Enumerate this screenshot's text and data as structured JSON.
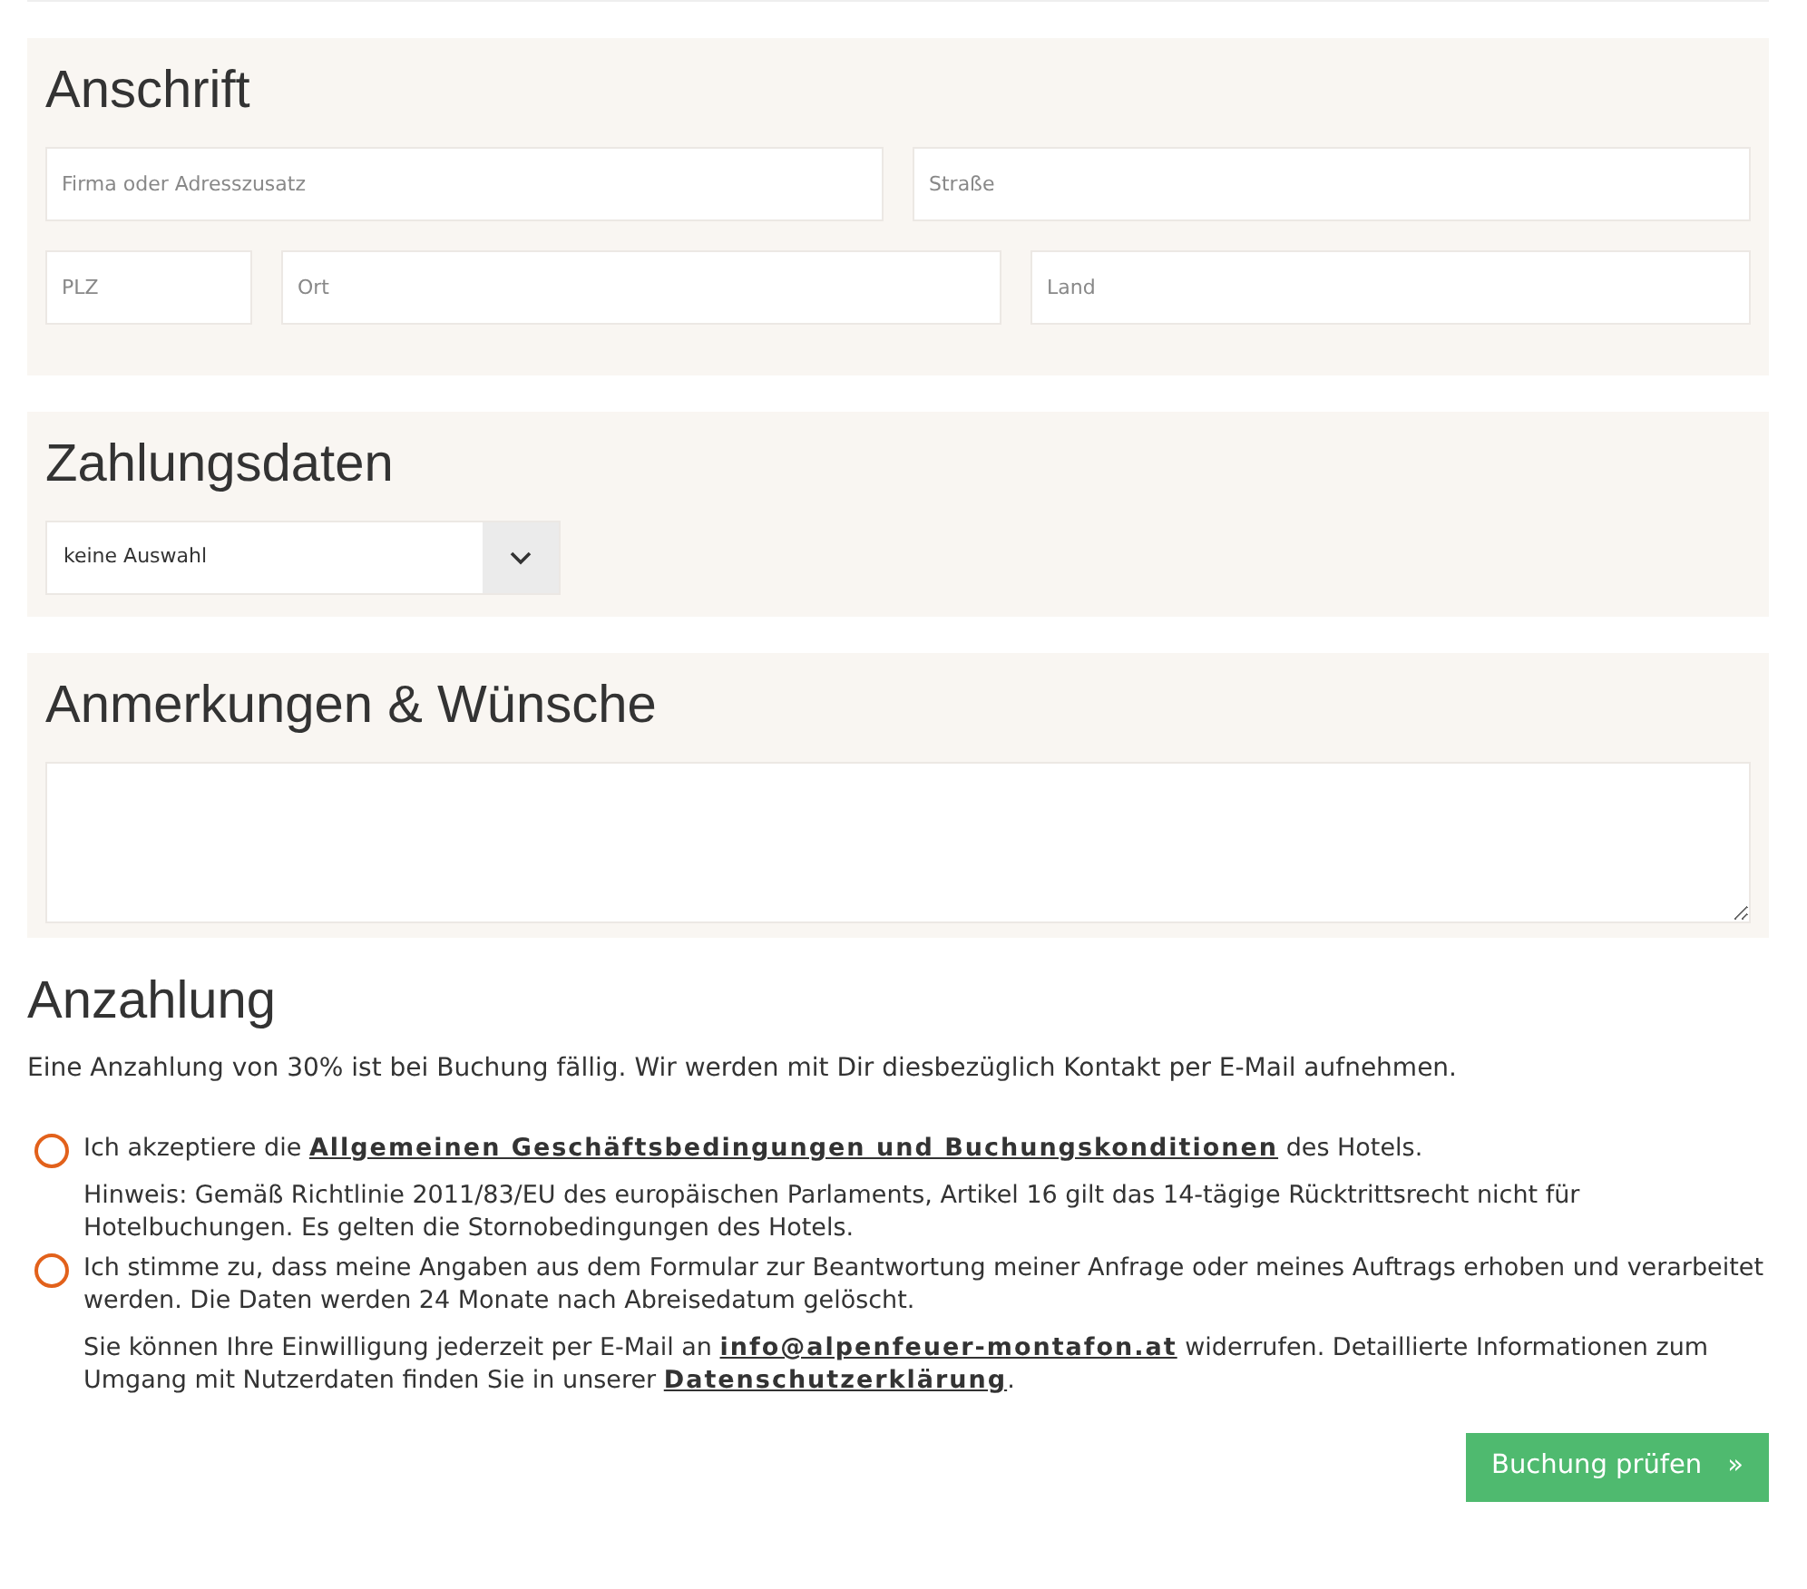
{
  "address": {
    "title": "Anschrift",
    "fields": [
      {
        "placeholder": "Firma oder Adresszusatz"
      },
      {
        "placeholder": "Straße"
      },
      {
        "placeholder": "PLZ"
      },
      {
        "placeholder": "Ort"
      },
      {
        "placeholder": "Land"
      }
    ]
  },
  "payment": {
    "title": "Zahlungsdaten",
    "select_value": "keine Auswahl"
  },
  "notes": {
    "title": "Anmerkungen & Wünsche"
  },
  "deposit": {
    "title": "Anzahlung",
    "text": "Eine Anzahlung von 30% ist bei Buchung fällig. Wir werden mit Dir diesbezüglich Kontakt per E-Mail aufnehmen.",
    "consents": [
      {
        "checked": false,
        "before": "Ich akzeptiere die",
        "link": "Allgemeinen Geschäftsbedingungen und Buchungskonditionen",
        "after": "des Hotels.",
        "note": [
          {
            "text": "Hinweis: Gemäß Richtlinie 2011/83/EU des europäischen Parlaments, Artikel 16 gilt das 14-tägige Rücktrittsrecht nicht für Hotelbuchungen. Es gelten die Stornobedingungen des Hotels."
          }
        ]
      },
      {
        "checked": false,
        "before": "Ich stimme zu, dass meine Angaben aus dem Formular zur Beantwortung meiner Anfrage oder meines Auftrags erhoben und verarbeitet werden. Die Daten werden 24 Monate nach Abreisedatum gelöscht.",
        "note": [
          {
            "text": "Sie können Ihre Einwilligung jederzeit per E-Mail an"
          },
          {
            "link": "info@alpenfeuer-montafon.at"
          },
          {
            "text": "widerrufen. Detaillierte Informationen zum Umgang mit Nutzerdaten finden Sie in unserer"
          },
          {
            "link": "Datenschutzerklärung",
            "after": "."
          }
        ]
      }
    ]
  },
  "submit": {
    "label": "Buchung prüfen",
    "icon": "»"
  }
}
